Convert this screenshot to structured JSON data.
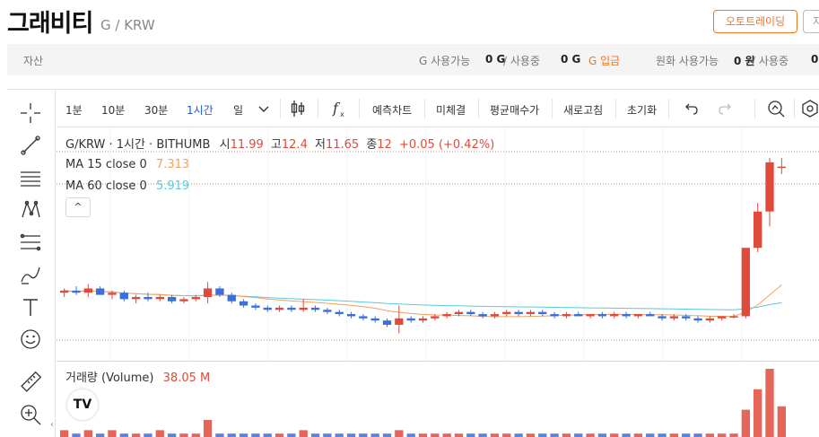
{
  "header": {
    "coin_name": "그래비티",
    "pair": "G / KRW",
    "auto_trading_button": "오토트레이딩",
    "next_button_partial": "자"
  },
  "asset_bar": {
    "label": "자산",
    "g_available_label": "G 사용가능",
    "g_available_value": "0 G",
    "in_use_label": " / 사용중",
    "g_in_use_value": "0 G",
    "deposit_link": "G 입금",
    "krw_available_label": "원화 사용가능",
    "krw_available_value": "0 원",
    "krw_in_use_label": " / 사용중",
    "krw_in_use_value": "0"
  },
  "toolbar": {
    "intervals": [
      "1분",
      "10분",
      "30분",
      "1시간",
      "일"
    ],
    "active_interval": "1시간",
    "buttons": [
      "예측차트",
      "미체결",
      "평균매수가",
      "새로고침",
      "초기화"
    ],
    "fx_label": "f"
  },
  "left_tools": [
    "crosshair-icon",
    "trend-line-icon",
    "horizontal-lines-icon",
    "pattern-icon",
    "fib-icon",
    "brush-icon",
    "text-icon",
    "emoji-icon",
    "ruler-icon",
    "zoom-in-icon"
  ],
  "legend": {
    "symbol": "G/KRW · 1시간 · BITHUMB",
    "open_label": "시",
    "open_value": "11.99",
    "high_label": "고",
    "high_value": "12.4",
    "low_label": "저",
    "low_value": "11.65",
    "close_label": "종",
    "close_value": "12",
    "change": "+0.05 (+0.42%)",
    "ma15_label": "MA 15 close 0",
    "ma15_value": "7.313",
    "ma60_label": "MA 60 close 0",
    "ma60_value": "5.919",
    "collapse_glyph": "^"
  },
  "volume": {
    "label": "거래량 (Volume)",
    "value": "38.05 M",
    "logo_text": "TV"
  },
  "colors": {
    "up": "#e04a3b",
    "down": "#3b6fd9",
    "ma15": "#f0a060",
    "ma60": "#5bc8dc",
    "accent": "#f37321",
    "active_interval": "#1e55d8"
  },
  "chart_data": {
    "type": "candlestick",
    "series": [
      {
        "name": "G/KRW",
        "ohlc": [
          [
            6.1,
            6.3,
            5.9,
            6.2
          ],
          [
            6.2,
            6.4,
            6.0,
            6.1
          ],
          [
            6.1,
            6.5,
            5.9,
            6.3
          ],
          [
            6.3,
            6.4,
            6.0,
            6.0
          ],
          [
            6.0,
            6.2,
            5.8,
            6.1
          ],
          [
            6.1,
            6.2,
            5.7,
            5.8
          ],
          [
            5.8,
            6.0,
            5.6,
            5.9
          ],
          [
            5.9,
            6.1,
            5.7,
            5.8
          ],
          [
            5.8,
            6.0,
            5.7,
            5.9
          ],
          [
            5.9,
            6.0,
            5.6,
            5.7
          ],
          [
            5.7,
            5.9,
            5.6,
            5.8
          ],
          [
            5.8,
            6.0,
            5.7,
            5.9
          ],
          [
            5.9,
            6.6,
            5.6,
            6.3
          ],
          [
            6.3,
            6.4,
            5.9,
            6.0
          ],
          [
            6.0,
            6.1,
            5.6,
            5.7
          ],
          [
            5.7,
            5.8,
            5.4,
            5.5
          ],
          [
            5.5,
            5.6,
            5.3,
            5.4
          ],
          [
            5.4,
            5.5,
            5.2,
            5.3
          ],
          [
            5.3,
            5.5,
            5.2,
            5.4
          ],
          [
            5.4,
            5.5,
            5.2,
            5.3
          ],
          [
            5.3,
            5.8,
            5.2,
            5.4
          ],
          [
            5.4,
            5.5,
            5.2,
            5.3
          ],
          [
            5.3,
            5.4,
            5.1,
            5.2
          ],
          [
            5.2,
            5.3,
            5.0,
            5.1
          ],
          [
            5.1,
            5.2,
            4.9,
            5.0
          ],
          [
            5.0,
            5.1,
            4.8,
            4.9
          ],
          [
            4.9,
            5.0,
            4.7,
            4.8
          ],
          [
            4.8,
            4.9,
            4.5,
            4.6
          ],
          [
            4.6,
            5.5,
            4.2,
            4.9
          ],
          [
            4.9,
            5.0,
            4.7,
            4.8
          ],
          [
            4.8,
            5.0,
            4.7,
            4.9
          ],
          [
            4.9,
            5.1,
            4.8,
            5.0
          ],
          [
            5.0,
            5.2,
            4.9,
            5.1
          ],
          [
            5.1,
            5.3,
            5.0,
            5.2
          ],
          [
            5.2,
            5.3,
            5.0,
            5.1
          ],
          [
            5.1,
            5.2,
            4.9,
            5.0
          ],
          [
            5.0,
            5.2,
            4.9,
            5.1
          ],
          [
            5.1,
            5.3,
            5.0,
            5.2
          ],
          [
            5.2,
            5.3,
            5.0,
            5.1
          ],
          [
            5.1,
            5.3,
            5.0,
            5.2
          ],
          [
            5.2,
            5.3,
            5.0,
            5.1
          ],
          [
            5.1,
            5.2,
            4.9,
            5.0
          ],
          [
            5.0,
            5.2,
            4.9,
            5.1
          ],
          [
            5.1,
            5.2,
            5.0,
            5.0
          ],
          [
            5.0,
            5.1,
            4.9,
            5.1
          ],
          [
            5.1,
            5.2,
            4.9,
            5.0
          ],
          [
            5.0,
            5.2,
            4.9,
            5.1
          ],
          [
            5.1,
            5.2,
            4.9,
            5.0
          ],
          [
            5.0,
            5.1,
            4.9,
            5.1
          ],
          [
            5.1,
            5.2,
            5.0,
            5.0
          ],
          [
            5.0,
            5.1,
            4.8,
            4.9
          ],
          [
            4.9,
            5.1,
            4.8,
            5.0
          ],
          [
            5.0,
            5.1,
            4.8,
            4.9
          ],
          [
            4.9,
            5.0,
            4.7,
            4.8
          ],
          [
            4.8,
            5.0,
            4.7,
            4.9
          ],
          [
            4.9,
            5.0,
            4.8,
            5.0
          ],
          [
            5.0,
            5.1,
            4.9,
            5.0
          ],
          [
            5.0,
            5.5,
            4.9,
            8.2
          ],
          [
            8.2,
            10.3,
            8.0,
            9.9
          ],
          [
            9.9,
            12.4,
            9.2,
            12.2
          ],
          [
            12.0,
            12.4,
            11.65,
            12.0
          ]
        ]
      },
      {
        "name": "MA 15 close 0",
        "last": 7.313
      },
      {
        "name": "MA 60 close 0",
        "last": 5.919
      }
    ],
    "volume_relative": [
      2,
      1,
      2,
      1,
      2,
      1,
      1,
      1,
      2,
      1,
      1,
      1,
      5,
      1,
      1,
      1,
      1,
      1,
      1,
      1,
      2,
      1,
      1,
      1,
      1,
      1,
      1,
      1,
      2,
      1,
      1,
      1,
      1,
      1,
      1,
      1,
      1,
      1,
      1,
      1,
      1,
      1,
      1,
      1,
      1,
      1,
      1,
      1,
      1,
      1,
      1,
      1,
      1,
      1,
      1,
      1,
      1,
      8,
      14,
      20,
      9
    ]
  }
}
